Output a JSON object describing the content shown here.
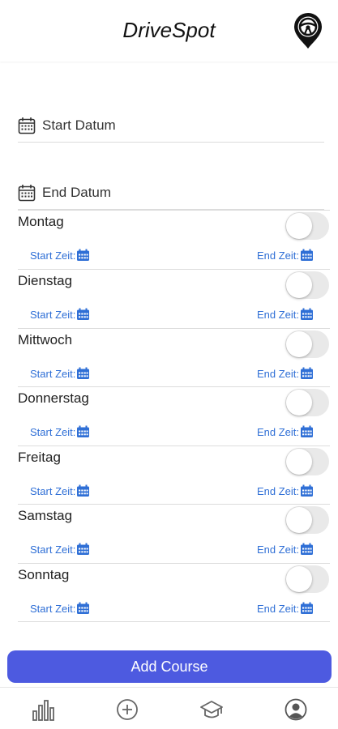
{
  "header": {
    "title": "DriveSpot",
    "logo_icon": "steering-wheel-pin-icon"
  },
  "dates": {
    "start_label": "Start Datum",
    "end_label": "End Datum",
    "icon": "calendar-icon"
  },
  "days": [
    {
      "name": "Montag",
      "enabled": false,
      "start_label": "Start Zeit:",
      "end_label": "End Zeit:"
    },
    {
      "name": "Dienstag",
      "enabled": false,
      "start_label": "Start Zeit:",
      "end_label": "End Zeit:"
    },
    {
      "name": "Mittwoch",
      "enabled": false,
      "start_label": "Start Zeit:",
      "end_label": "End Zeit:"
    },
    {
      "name": "Donnerstag",
      "enabled": false,
      "start_label": "Start Zeit:",
      "end_label": "End Zeit:"
    },
    {
      "name": "Freitag",
      "enabled": false,
      "start_label": "Start Zeit:",
      "end_label": "End Zeit:"
    },
    {
      "name": "Samstag",
      "enabled": false,
      "start_label": "Start Zeit:",
      "end_label": "End Zeit:"
    },
    {
      "name": "Sonntag",
      "enabled": false,
      "start_label": "Start Zeit:",
      "end_label": "End Zeit:"
    }
  ],
  "actions": {
    "add_course_label": "Add Course"
  },
  "tabbar": {
    "items": [
      {
        "icon": "bar-chart-icon"
      },
      {
        "icon": "plus-circle-icon"
      },
      {
        "icon": "graduation-cap-icon"
      },
      {
        "icon": "user-circle-icon"
      }
    ]
  },
  "colors": {
    "accent": "#4d5ae0",
    "link": "#2f6fd6",
    "toggle_off": "#e9e9e9"
  }
}
